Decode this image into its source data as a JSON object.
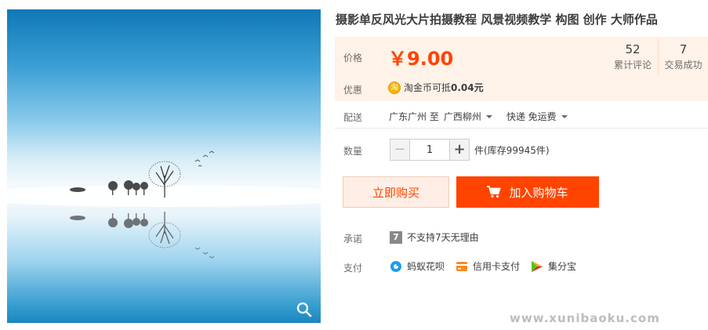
{
  "product": {
    "title": "摄影单反风光大片拍摄教程 风景视频教学 构图 创作 大师作品",
    "image_alt": "",
    "price_label": "价格",
    "price": "￥9.00",
    "stats": [
      {
        "value": "52",
        "label": "累计评论"
      },
      {
        "value": "7",
        "label": "交易成功"
      }
    ],
    "promo_label": "优惠",
    "promo_icon": "淘",
    "promo_text": "淘金币可抵",
    "promo_amount": "0.04元"
  },
  "shipping": {
    "label": "配送",
    "from": "广东广州 至",
    "to": "广西柳州",
    "method": "快递 免运费"
  },
  "quantity": {
    "label": "数量",
    "minus": "−",
    "plus": "+",
    "value": "1",
    "stock": "件(库存99945件)"
  },
  "actions": {
    "buy_now": "立即购买",
    "add_to_cart": "加入购物车"
  },
  "promise": {
    "label": "承诺",
    "icon_text": "7",
    "text": "不支持7天无理由"
  },
  "payment": {
    "label": "支付",
    "methods": [
      "蚂蚁花呗",
      "信用卡支付",
      "集分宝"
    ]
  },
  "watermark": "www.xunibaoku.com",
  "colors": {
    "accent": "#ff4400",
    "price_bg": "#fff2e8"
  }
}
